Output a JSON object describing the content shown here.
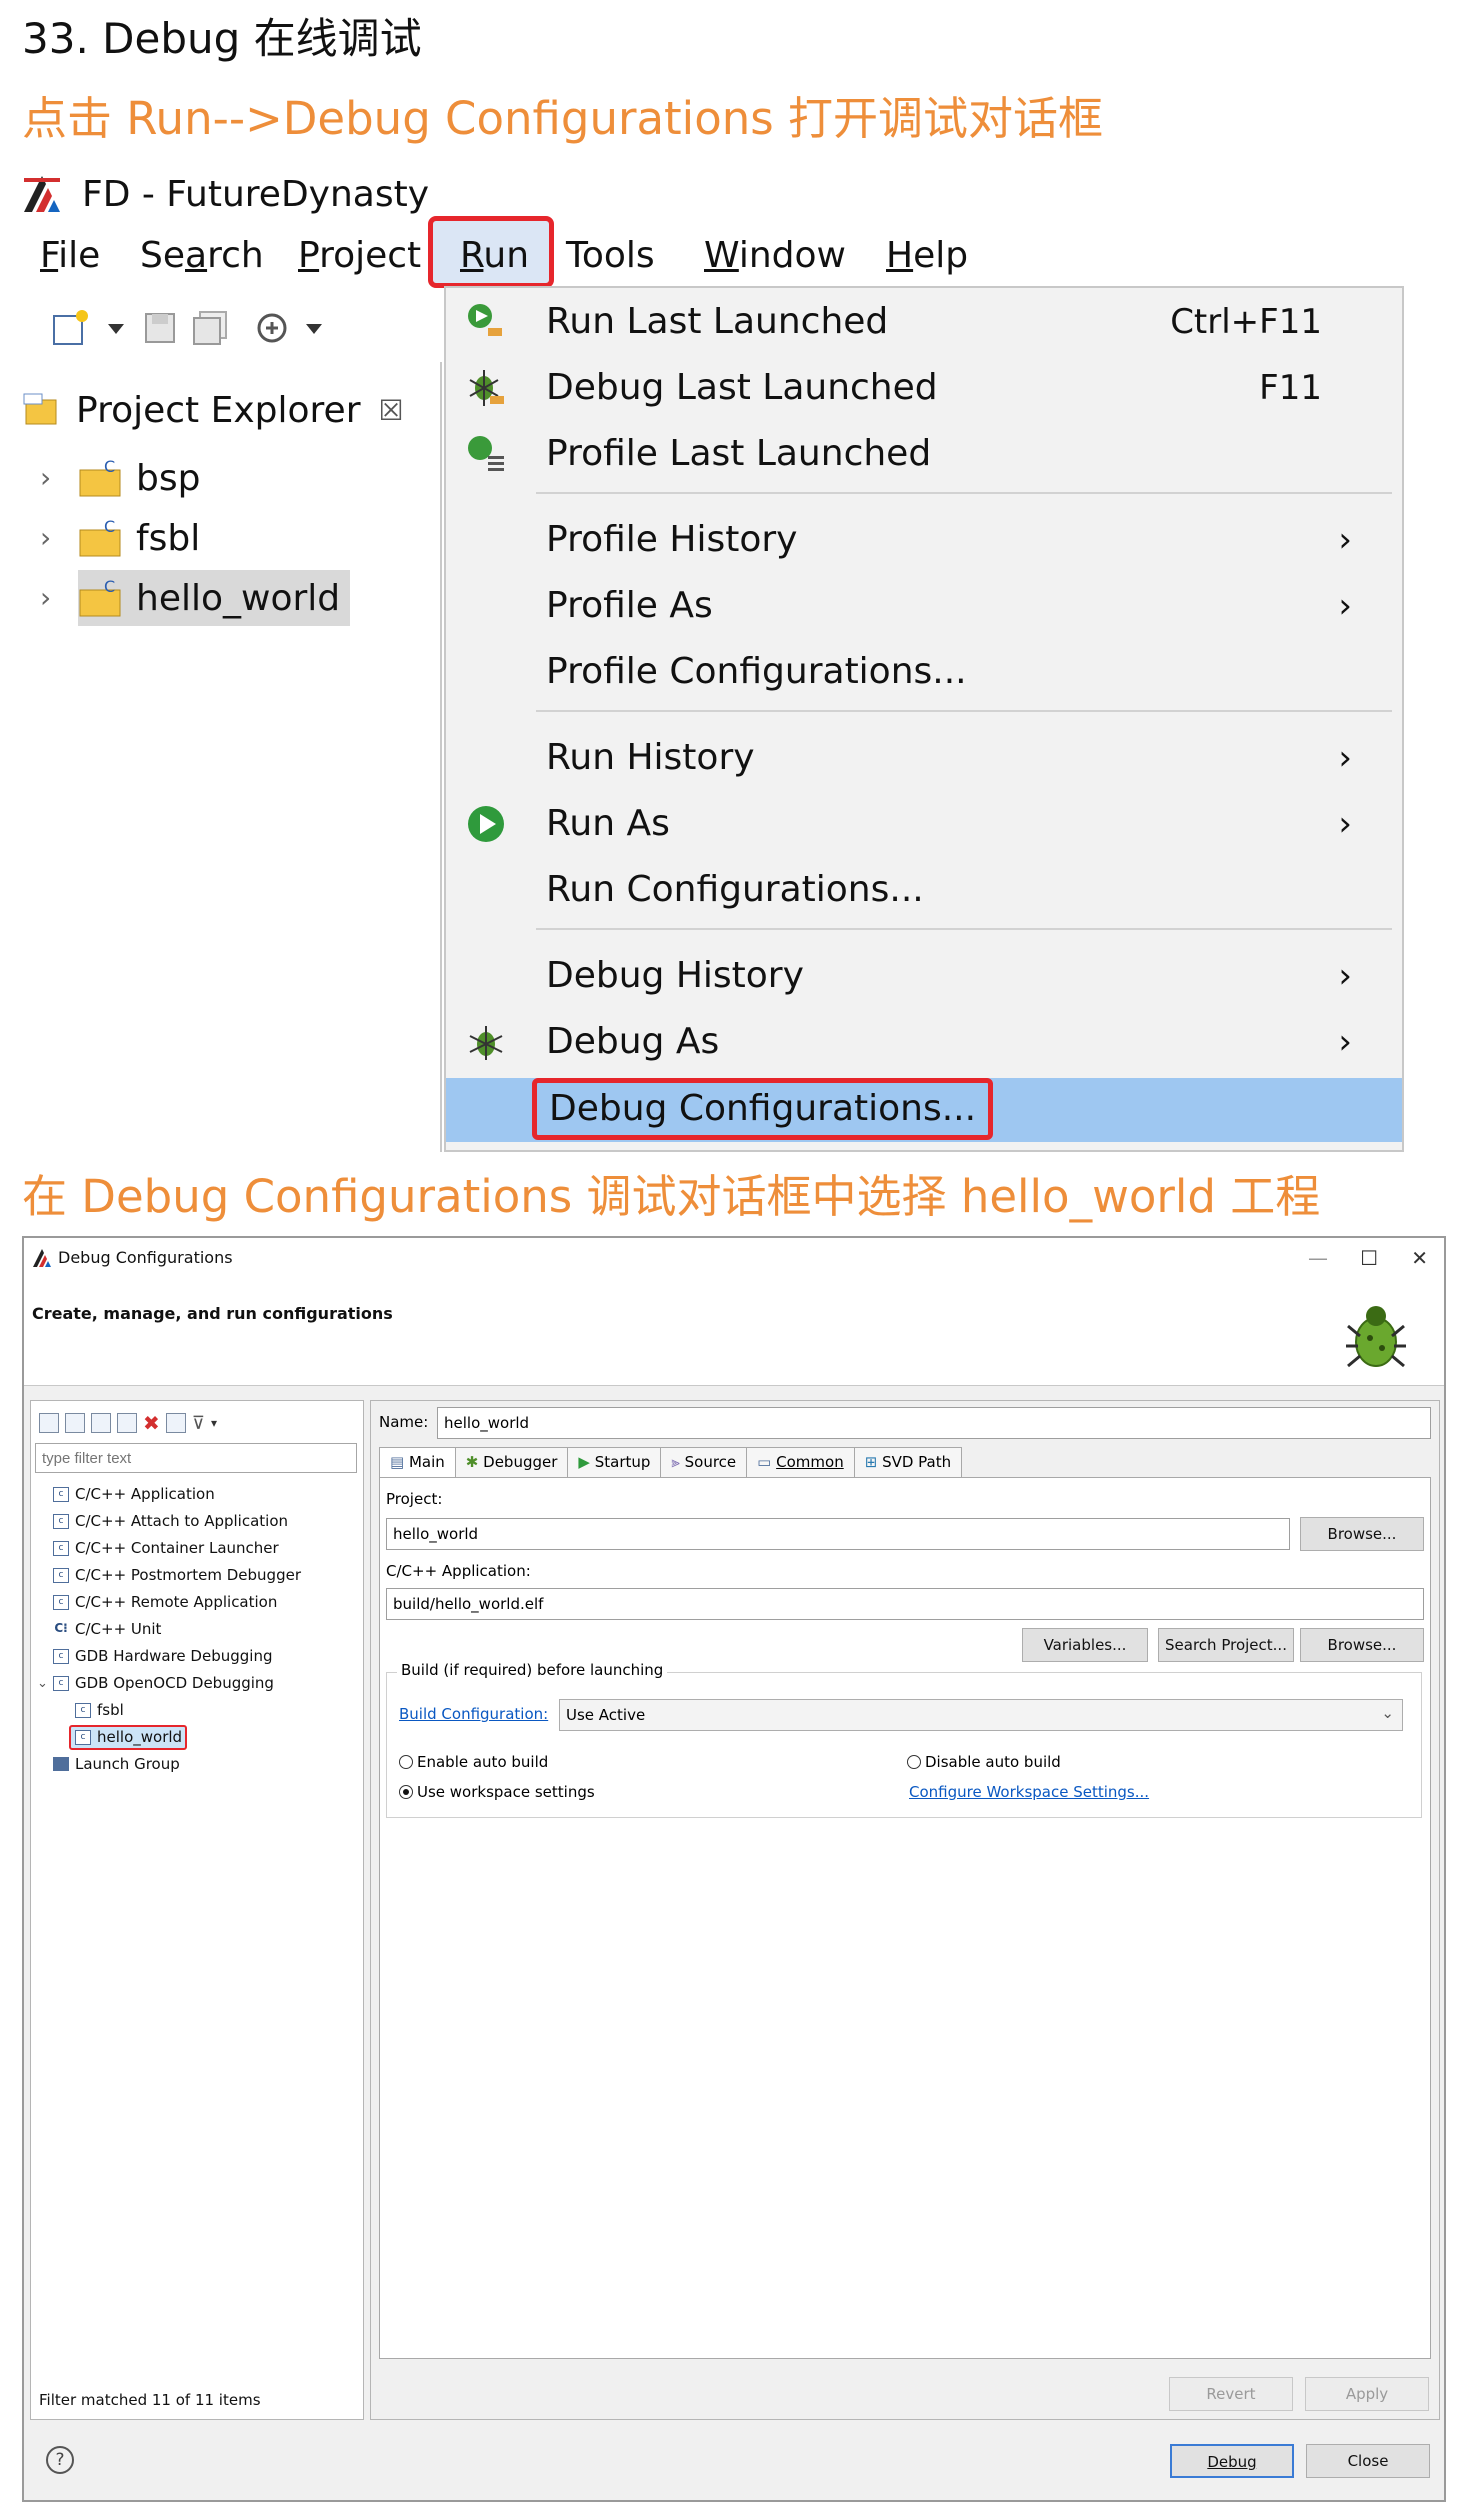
{
  "headings": {
    "main": "33. Debug 在线调试",
    "step1": "点击 Run-->Debug  Configurations 打开调试对话框",
    "step2": "在 Debug  Configurations 调试对话框中选择 hello_world 工程"
  },
  "colors": {
    "accent_orange": "#ee8e3a",
    "highlight_red": "#e6262c",
    "menu_highlight": "#9ec7f1",
    "link_blue": "#0a58c2"
  },
  "ide": {
    "title": "FD - FutureDynasty",
    "menu": [
      {
        "label": "File",
        "u": "F",
        "rest": "ile"
      },
      {
        "label": "Search",
        "pre": "Se",
        "u": "a",
        "rest": "rch"
      },
      {
        "label": "Project",
        "u": "P",
        "rest": "roject"
      },
      {
        "label": "Run",
        "u": "R",
        "rest": "un"
      },
      {
        "label": "Tools",
        "u": "",
        "rest": "Tools"
      },
      {
        "label": "Window",
        "u": "W",
        "rest": "indow"
      },
      {
        "label": "Help",
        "u": "H",
        "rest": "elp"
      }
    ],
    "project_explorer": {
      "title": "Project Explorer",
      "close": "☒",
      "projects": [
        "bsp",
        "fsbl",
        "hello_world"
      ]
    },
    "run_menu": {
      "items": [
        {
          "label": "Run Last Launched",
          "accel": "Ctrl+F11",
          "icon": "run-last-icon"
        },
        {
          "label": "Debug Last Launched",
          "accel": "F11",
          "icon": "debug-last-icon"
        },
        {
          "label": "Profile Last Launched",
          "accel": "",
          "icon": "profile-last-icon"
        },
        {
          "label": "Profile History",
          "arrow": "›"
        },
        {
          "label": "Profile As",
          "arrow": "›"
        },
        {
          "label": "Profile Configurations..."
        },
        {
          "label": "Run History",
          "arrow": "›"
        },
        {
          "label": "Run As",
          "arrow": "›",
          "icon": "run-as-icon"
        },
        {
          "label": "Run Configurations..."
        },
        {
          "label": "Debug History",
          "arrow": "›"
        },
        {
          "label": "Debug As",
          "arrow": "›",
          "icon": "debug-as-icon"
        },
        {
          "label": "Debug Configurations..."
        }
      ]
    }
  },
  "dialog": {
    "title": "Debug Configurations",
    "header": "Create, manage, and run configurations",
    "window_buttons": [
      "—",
      "☐",
      "✕"
    ],
    "filter_placeholder": "type filter text",
    "tree": [
      {
        "label": "C/C++ Application"
      },
      {
        "label": "C/C++ Attach to Application"
      },
      {
        "label": "C/C++ Container Launcher"
      },
      {
        "label": "C/C++ Postmortem Debugger"
      },
      {
        "label": "C/C++ Remote Application"
      },
      {
        "label": "C/C++ Unit"
      },
      {
        "label": "GDB Hardware Debugging"
      },
      {
        "label": "GDB OpenOCD Debugging"
      },
      {
        "label": "fsbl"
      },
      {
        "label": "hello_world"
      },
      {
        "label": "Launch Group"
      }
    ],
    "filter_status": "Filter matched 11 of 11 items",
    "name_label": "Name:",
    "name_value": "hello_world",
    "tabs": [
      "Main",
      "Debugger",
      "Startup",
      "Source",
      "Common",
      "SVD Path"
    ],
    "project_label": "Project:",
    "project_value": "hello_world",
    "browse1": "Browse...",
    "app_label": "C/C++ Application:",
    "app_value": "build/hello_world.elf",
    "variables": "Variables...",
    "search_project": "Search Project...",
    "browse2": "Browse...",
    "build_group": "Build (if required) before launching",
    "build_config_label": "Build Configuration:",
    "build_config_value": "Use Active",
    "radio_enable": "Enable auto build",
    "radio_disable": "Disable auto build",
    "radio_workspace": "Use workspace settings",
    "configure_link": "Configure Workspace Settings...",
    "revert": "Revert",
    "apply": "Apply",
    "debug": "Debug",
    "close": "Close",
    "help": "?"
  }
}
